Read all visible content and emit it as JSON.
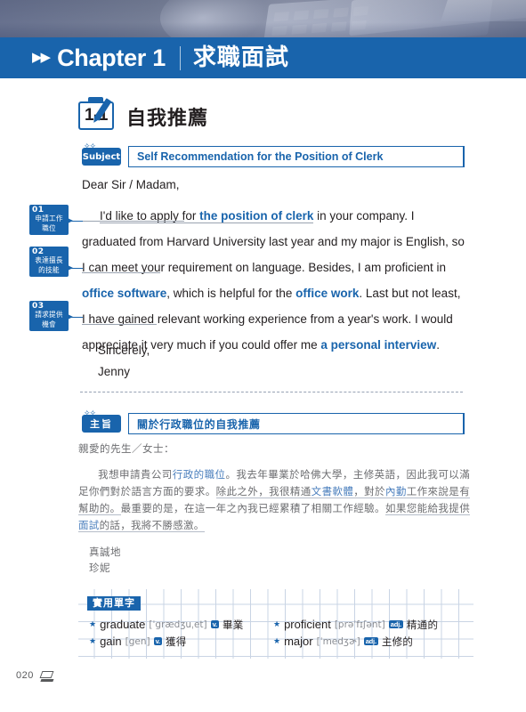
{
  "header": {
    "chevron": "▶▶",
    "chapter_en": "Chapter 1",
    "chapter_zh": "求職面試"
  },
  "section": {
    "number": "1-1",
    "title_zh": "自我推薦"
  },
  "english_letter": {
    "subject_tag": "Subject",
    "subject_value": "Self Recommendation for the Position of Clerk",
    "salutation": "Dear Sir / Madam,",
    "paragraph": {
      "t1": "I'd like to apply for ",
      "kw1": "the position of clerk",
      "t2": " in your company. I graduated from Harvard University last year and my major is English, so I can meet your requirement on language. Besides, I am proficient in ",
      "kw2": "office software",
      "t3": ", which is helpful for the ",
      "kw3": "office work",
      "t4": ". Last but not least, I have gained relevant working experience from a year's work. I would appreciate it very much if you could offer me ",
      "kw4": "a personal interview",
      "t5": "."
    },
    "closing": "Sincerely,",
    "signature": "Jenny"
  },
  "callouts": [
    {
      "num": "01",
      "line1": "申請工作",
      "line2": "職位"
    },
    {
      "num": "02",
      "line1": "表達擅長",
      "line2": "的技能"
    },
    {
      "num": "03",
      "line1": "請求提供",
      "line2": "機會"
    }
  ],
  "chinese_letter": {
    "subject_tag": "主旨",
    "subject_value": "關於行政職位的自我推薦",
    "salutation": "親愛的先生／女士：",
    "p1a": "我想申請貴公司",
    "p1link": "行政的職位",
    "p1b": "。我去年畢業於哈佛大學，主修英語，因此我可以滿足你們對於語言方面的要求。",
    "p1c": "除此之外，我很精通",
    "p1link2": "文書軟體",
    "p1d": "，對於",
    "p1link3": "內勤",
    "p1e": "工作來說是有幫助的。",
    "p1f": "最重要的是，在這一年之內我已經累積了相關工作經驗。",
    "p1g": "如果您能給我提供",
    "p1link4": "面試",
    "p1h": "的話，我將不勝感激。",
    "closing": "真誠地",
    "signature": "珍妮"
  },
  "vocab": {
    "title": "實用單字",
    "items": [
      {
        "word": "graduate",
        "ipa": "[ˈgrædʒuˌet]",
        "pos": "v.",
        "def": "畢業"
      },
      {
        "word": "proficient",
        "ipa": "[prəˈfɪʃənt]",
        "pos": "adj.",
        "def": "精通的"
      },
      {
        "word": "gain",
        "ipa": "[gen]",
        "pos": "v.",
        "def": "獲得"
      },
      {
        "word": "major",
        "ipa": "[ˈmedʒɚ]",
        "pos": "adj.",
        "def": "主修的"
      }
    ]
  },
  "footer": {
    "page_number": "020"
  },
  "colors": {
    "brand_blue": "#1964ac",
    "link_blue": "#4b7fbd",
    "body_gray": "#6d6e71"
  }
}
